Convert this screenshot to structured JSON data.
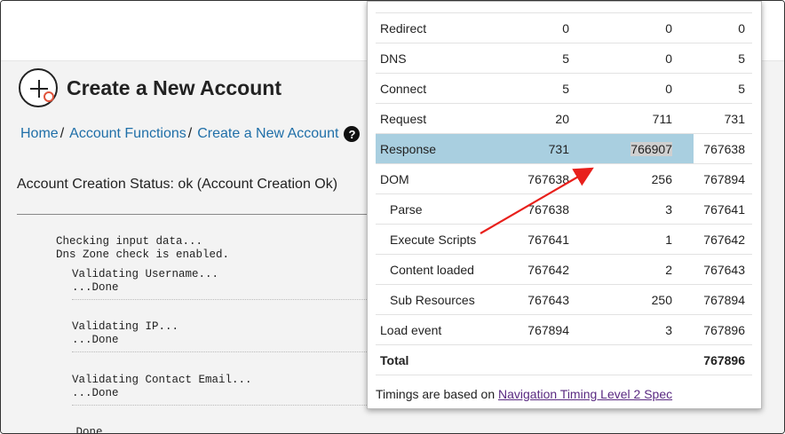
{
  "page": {
    "title": "Create a New Account",
    "breadcrumb": {
      "home": "Home",
      "sep": "/",
      "account_functions": "Account Functions",
      "current": "Create a New Account",
      "help_glyph": "?"
    },
    "status_text": "Account Creation Status: ok (Account Creation Ok)",
    "log": {
      "l1": "Checking input data...",
      "l2": "Dns Zone check is enabled.",
      "l3": "Validating Username...",
      "l4": "...Done",
      "l5": "Validating IP...",
      "l6": "...Done",
      "l7": "Validating Contact Email...",
      "l8": "...Done",
      "l9": "...Done"
    }
  },
  "timing_popup": {
    "rows": [
      {
        "name": "Redirect",
        "c1": "0",
        "c2": "0",
        "c3": "0"
      },
      {
        "name": "DNS",
        "c1": "5",
        "c2": "0",
        "c3": "5"
      },
      {
        "name": "Connect",
        "c1": "5",
        "c2": "0",
        "c3": "5"
      },
      {
        "name": "Request",
        "c1": "20",
        "c2": "711",
        "c3": "731"
      },
      {
        "name": "Response",
        "c1": "731",
        "c2": "766907",
        "c3": "767638"
      },
      {
        "name": "DOM",
        "c1": "767638",
        "c2": "256",
        "c3": "767894"
      },
      {
        "name": "Parse",
        "c1": "767638",
        "c2": "3",
        "c3": "767641"
      },
      {
        "name": "Execute Scripts",
        "c1": "767641",
        "c2": "1",
        "c3": "767642"
      },
      {
        "name": "Content loaded",
        "c1": "767642",
        "c2": "2",
        "c3": "767643"
      },
      {
        "name": "Sub Resources",
        "c1": "767643",
        "c2": "250",
        "c3": "767894"
      },
      {
        "name": "Load event",
        "c1": "767894",
        "c2": "3",
        "c3": "767896"
      },
      {
        "name": "Total",
        "c1": "",
        "c2": "",
        "c3": "767896"
      }
    ],
    "footer_prefix": "Timings are based on ",
    "footer_link": "Navigation Timing Level 2 Spec"
  },
  "colors": {
    "highlight_row": "#a9cfe0",
    "arrow": "#e8201c",
    "link": "#1f6fa8"
  }
}
